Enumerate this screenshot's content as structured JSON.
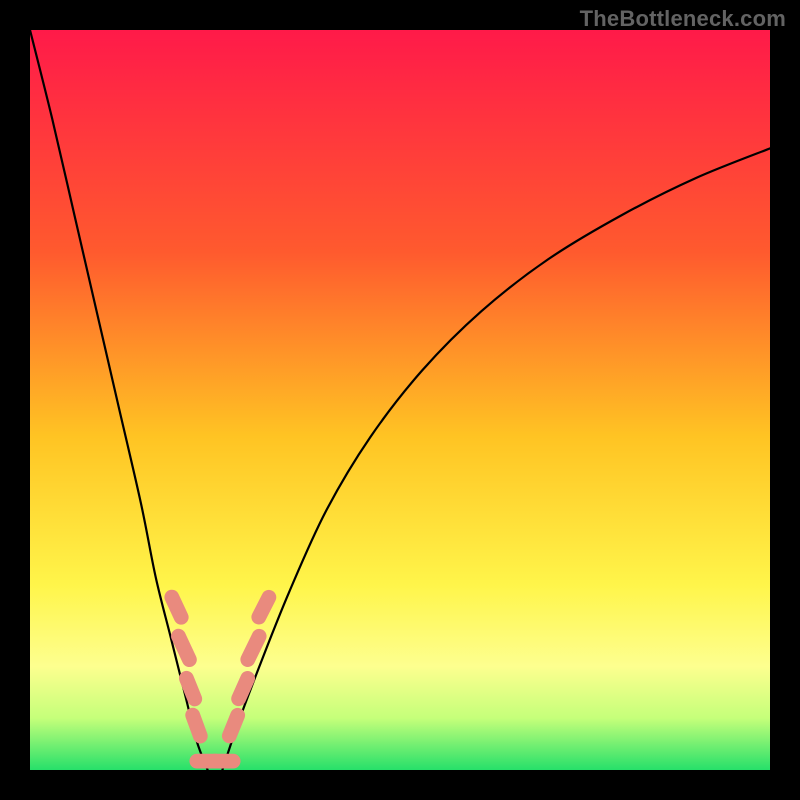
{
  "watermark": {
    "text": "TheBottleneck.com"
  },
  "chart_data": {
    "type": "line",
    "title": "",
    "xlabel": "",
    "ylabel": "",
    "xlim": [
      0,
      100
    ],
    "ylim": [
      0,
      100
    ],
    "gradient_stops": [
      {
        "offset": 0,
        "color": "#ff1a49"
      },
      {
        "offset": 30,
        "color": "#ff5a2e"
      },
      {
        "offset": 55,
        "color": "#ffc423"
      },
      {
        "offset": 75,
        "color": "#fff54a"
      },
      {
        "offset": 86,
        "color": "#fdff8f"
      },
      {
        "offset": 93,
        "color": "#c5ff7a"
      },
      {
        "offset": 100,
        "color": "#26e06a"
      }
    ],
    "series": [
      {
        "name": "left-branch",
        "x": [
          0,
          3,
          6,
          9,
          12,
          15,
          17,
          19,
          21,
          22.5,
          24
        ],
        "y": [
          100,
          88,
          75,
          62,
          49,
          36,
          26,
          18,
          10,
          4,
          0
        ]
      },
      {
        "name": "right-branch",
        "x": [
          26,
          28,
          31,
          35,
          40,
          46,
          53,
          61,
          70,
          80,
          90,
          100
        ],
        "y": [
          0,
          6,
          14,
          24,
          35,
          45,
          54,
          62,
          69,
          75,
          80,
          84
        ]
      }
    ],
    "markers": {
      "name": "data-points",
      "color": "#e98a7e",
      "points": [
        {
          "x": 19.8,
          "y": 22.0,
          "w": 2.0,
          "h": 5.0,
          "rot": -25
        },
        {
          "x": 20.8,
          "y": 16.5,
          "w": 2.0,
          "h": 5.5,
          "rot": -25
        },
        {
          "x": 21.7,
          "y": 11.0,
          "w": 2.0,
          "h": 5.0,
          "rot": -22
        },
        {
          "x": 22.5,
          "y": 6.0,
          "w": 2.0,
          "h": 5.0,
          "rot": -20
        },
        {
          "x": 23.8,
          "y": 1.2,
          "w": 4.5,
          "h": 2.0,
          "rot": 0
        },
        {
          "x": 26.2,
          "y": 1.2,
          "w": 4.5,
          "h": 2.0,
          "rot": 0
        },
        {
          "x": 27.5,
          "y": 6.0,
          "w": 2.0,
          "h": 5.0,
          "rot": 22
        },
        {
          "x": 28.8,
          "y": 11.0,
          "w": 2.0,
          "h": 5.0,
          "rot": 24
        },
        {
          "x": 30.2,
          "y": 16.5,
          "w": 2.0,
          "h": 5.5,
          "rot": 26
        },
        {
          "x": 31.6,
          "y": 22.0,
          "w": 2.0,
          "h": 5.0,
          "rot": 27
        }
      ]
    }
  }
}
